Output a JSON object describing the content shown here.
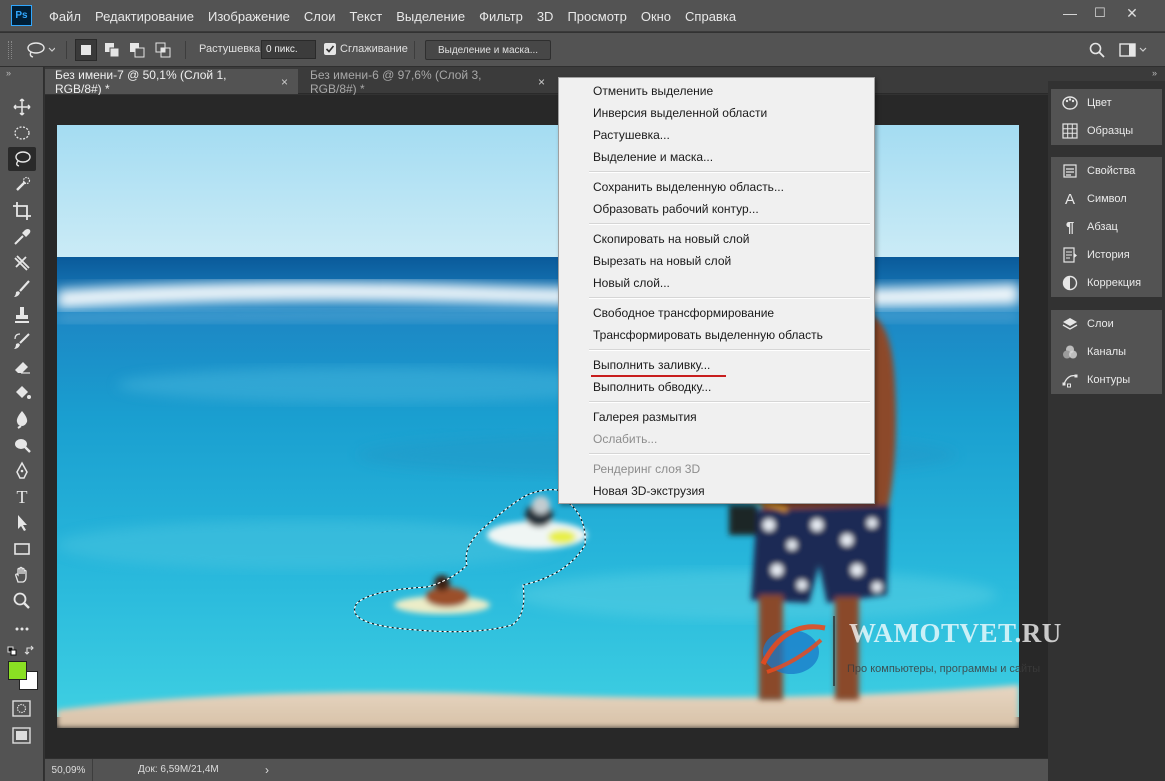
{
  "app": {
    "logo": "Ps"
  },
  "menu": [
    "Файл",
    "Редактирование",
    "Изображение",
    "Слои",
    "Текст",
    "Выделение",
    "Фильтр",
    "3D",
    "Просмотр",
    "Окно",
    "Справка"
  ],
  "window_controls": {
    "minimize": "—",
    "maximize": "☐",
    "close": "✕"
  },
  "options": {
    "feather_label": "Растушевка:",
    "feather_value": "0 пикс.",
    "antialias_label": "Сглаживание",
    "antialias_checked": true,
    "select_mask_button": "Выделение и маска..."
  },
  "tabs": [
    {
      "label": "Без имени-7 @ 50,1% (Слой 1, RGB/8#) *",
      "active": true,
      "close": "×"
    },
    {
      "label": "Без имени-6 @ 97,6% (Слой 3, RGB/8#) *",
      "active": false,
      "close": "×"
    }
  ],
  "tools": [
    "move-tool",
    "ellipse-marquee-tool",
    "lasso-tool",
    "quick-selection-tool",
    "crop-tool",
    "eyedropper-tool",
    "healing-brush-tool",
    "brush-tool",
    "clone-stamp-tool",
    "history-brush-tool",
    "eraser-tool",
    "paint-bucket-tool",
    "blur-tool",
    "dodge-tool",
    "pen-tool",
    "type-tool",
    "path-selection-tool",
    "rectangle-tool",
    "hand-tool",
    "zoom-tool",
    "more-tools"
  ],
  "colors": {
    "foreground": "#8ae023",
    "background": "#ffffff",
    "accent": "#31a8ff",
    "annotation_underline": "#c81e1e"
  },
  "toolbar_text": {
    "grip": "»",
    "type_tool": "T"
  },
  "context_menu": {
    "groups": [
      [
        {
          "label": "Отменить выделение",
          "enabled": true
        },
        {
          "label": "Инверсия выделенной области",
          "enabled": true
        },
        {
          "label": "Растушевка...",
          "enabled": true
        },
        {
          "label": "Выделение и маска...",
          "enabled": true
        }
      ],
      [
        {
          "label": "Сохранить выделенную область...",
          "enabled": true
        },
        {
          "label": "Образовать рабочий контур...",
          "enabled": true
        }
      ],
      [
        {
          "label": "Скопировать на новый слой",
          "enabled": true
        },
        {
          "label": "Вырезать на новый слой",
          "enabled": true
        },
        {
          "label": "Новый слой...",
          "enabled": true
        }
      ],
      [
        {
          "label": "Свободное трансформирование",
          "enabled": true
        },
        {
          "label": "Трансформировать выделенную область",
          "enabled": true
        }
      ],
      [
        {
          "label": "Выполнить заливку...",
          "enabled": true,
          "underlined": true
        },
        {
          "label": "Выполнить обводку...",
          "enabled": true
        }
      ],
      [
        {
          "label": "Галерея размытия",
          "enabled": true
        },
        {
          "label": "Ослабить...",
          "enabled": false
        }
      ],
      [
        {
          "label": "Рендеринг слоя 3D",
          "enabled": false
        },
        {
          "label": "Новая 3D-экструзия",
          "enabled": true
        }
      ]
    ]
  },
  "panels": [
    [
      {
        "label": "Цвет",
        "icon": "color-palette-icon"
      },
      {
        "label": "Образцы",
        "icon": "swatches-grid-icon"
      }
    ],
    [
      {
        "label": "Свойства",
        "icon": "properties-icon"
      },
      {
        "label": "Символ",
        "icon": "character-icon"
      },
      {
        "label": "Абзац",
        "icon": "paragraph-icon"
      },
      {
        "label": "История",
        "icon": "history-icon"
      },
      {
        "label": "Коррекция",
        "icon": "adjustments-icon"
      }
    ],
    [
      {
        "label": "Слои",
        "icon": "layers-icon"
      },
      {
        "label": "Каналы",
        "icon": "channels-icon"
      },
      {
        "label": "Контуры",
        "icon": "paths-icon"
      }
    ]
  ],
  "panel_icon_text": {
    "character": "A",
    "paragraph": "¶"
  },
  "status": {
    "zoom": "50,09%",
    "doc": "Док: 6,59M/21,4M",
    "arrow": "›"
  },
  "watermark": {
    "title": "WAMOTVET.RU",
    "subtitle": "Про компьютеры, программы и сайты"
  }
}
